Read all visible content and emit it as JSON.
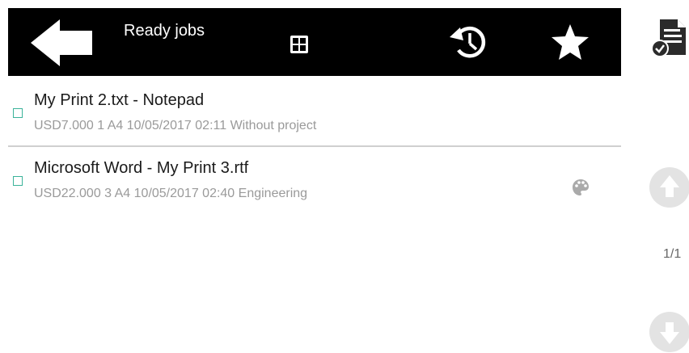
{
  "header": {
    "title": "Ready jobs",
    "back_icon": "back-arrow-icon",
    "grid_icon": "grid-view-icon",
    "history_icon": "history-icon",
    "favorite_icon": "star-icon"
  },
  "jobs": [
    {
      "title": "My Print 2.txt - Notepad",
      "meta": "USD7.000 1 A4 10/05/2017 02:11 Without project",
      "color": false
    },
    {
      "title": "Microsoft Word - My Print 3.rtf",
      "meta": "USD22.000 3 A4 10/05/2017 02:40 Engineering",
      "color": true
    }
  ],
  "sidebar": {
    "print_icon": "print-selected-icon",
    "scroll_up_icon": "arrow-up-icon",
    "scroll_down_icon": "arrow-down-icon",
    "page_indicator": "1/1"
  },
  "colors": {
    "header_bg": "#000000",
    "checkbox_border": "#3bb39a",
    "meta_text": "#9a9a9a",
    "disabled_button": "#e3e3e3"
  }
}
